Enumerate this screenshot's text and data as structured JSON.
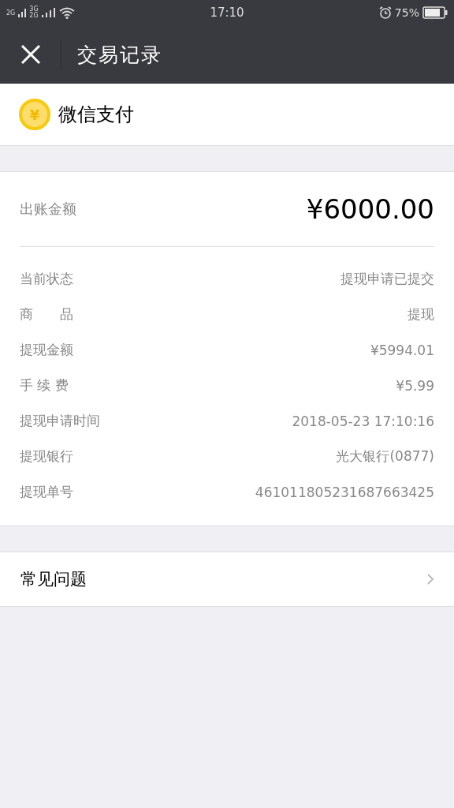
{
  "status_bar": {
    "networks": [
      "2G",
      "3G",
      "2G"
    ],
    "time": "17:10",
    "battery": "75%"
  },
  "header": {
    "title": "交易记录"
  },
  "merchant": {
    "name": "微信支付",
    "icon_symbol": "¥"
  },
  "amount": {
    "label": "出账金额",
    "value": "¥6000.00"
  },
  "details": [
    {
      "label": "当前状态",
      "value": "提现申请已提交"
    },
    {
      "label": "商　　品",
      "value": "提现"
    },
    {
      "label": "提现金额",
      "value": "¥5994.01"
    },
    {
      "label": "手 续 费",
      "value": "¥5.99"
    },
    {
      "label": "提现申请时间",
      "value": "2018-05-23 17:10:16"
    },
    {
      "label": "提现银行",
      "value": "光大银行(0877)"
    },
    {
      "label": "提现单号",
      "value": "461011805231687663425"
    }
  ],
  "faq": {
    "label": "常见问题"
  }
}
